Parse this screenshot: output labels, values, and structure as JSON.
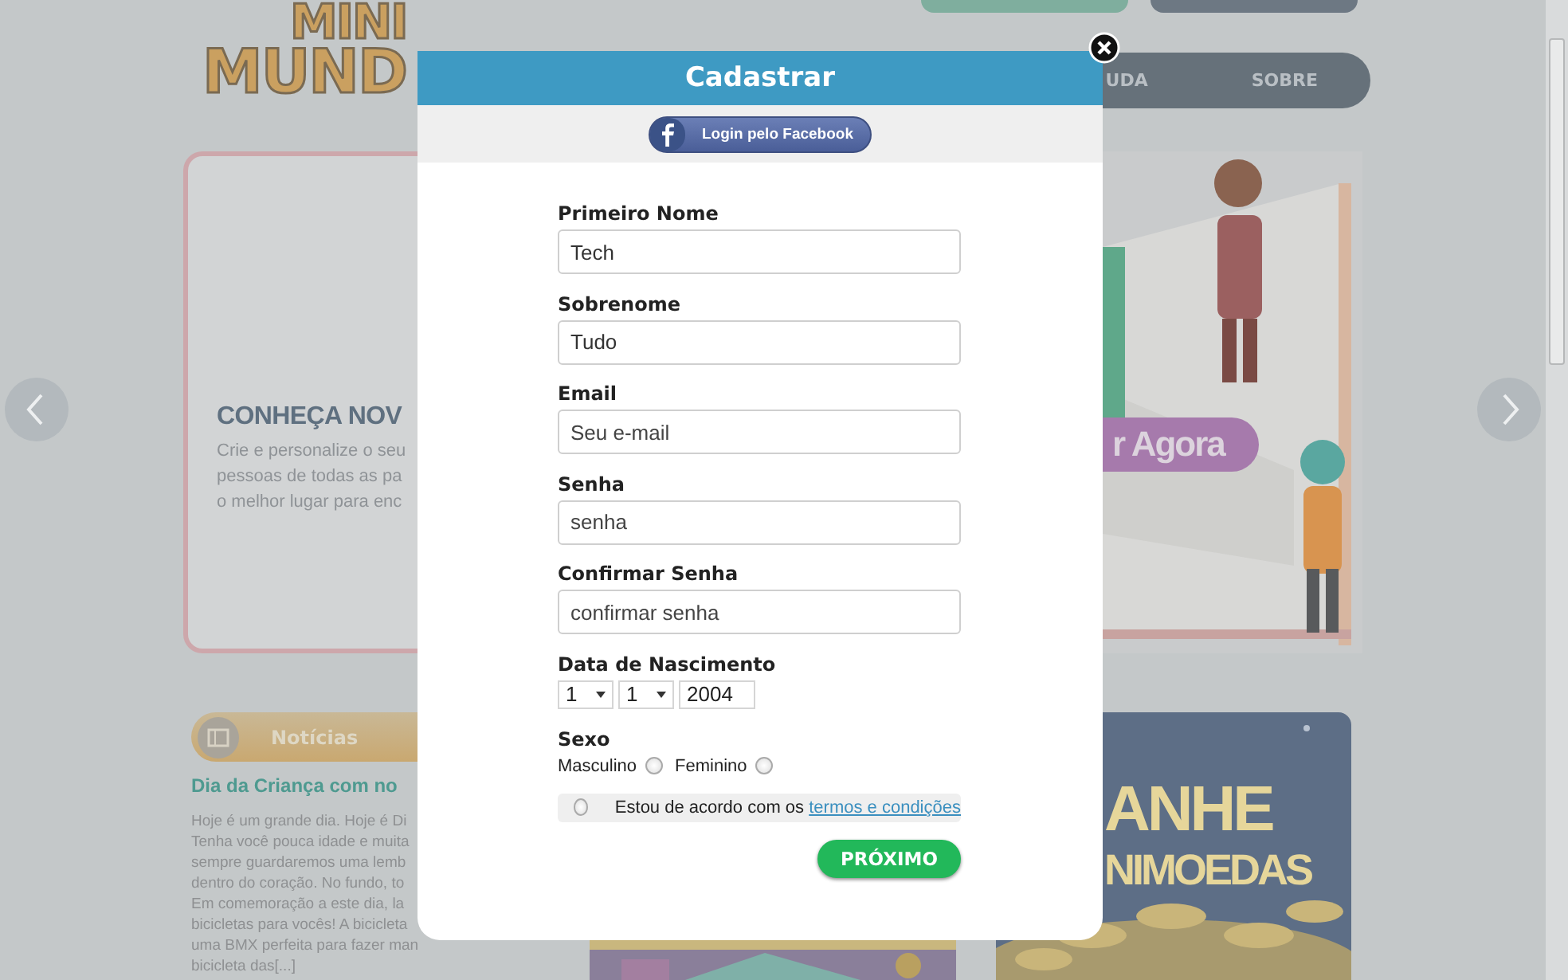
{
  "background": {
    "logo": [
      "MINI",
      "MUND"
    ],
    "nav": [
      "UDA",
      "SOBRE"
    ],
    "hero": {
      "title": "CONHEÇA NOV",
      "text": "Crie e personalize o seu\npessoas de todas as pa\no melhor lugar para enc",
      "button": "r Agora"
    },
    "news": {
      "heading": "Notícias",
      "title": "Dia da Criança com no",
      "text": "Hoje é um grande dia. Hoje é Di\nTenha você pouca idade e muita\nsempre guardaremos uma lemb\ndentro do coração. No fundo, to\nEm comemoração a este dia, la\nbicicletas para vocês! A bicicleta\numa BMX perfeita para fazer man\nbicicleta das[...]"
    },
    "banner": {
      "lines": [
        "ANHE",
        "NIMOEDAS"
      ]
    }
  },
  "modal": {
    "title": "Cadastrar",
    "facebook_button": "Login pelo Facebook",
    "fields": [
      {
        "label": "Primeiro Nome",
        "value": "Tech"
      },
      {
        "label": "Sobrenome",
        "value": "Tudo"
      },
      {
        "label": "Email",
        "placeholder": "Seu e-mail"
      },
      {
        "label": "Senha",
        "placeholder": "senha"
      },
      {
        "label": "Confirmar Senha",
        "placeholder": "confirmar senha"
      }
    ],
    "birth_date": {
      "label": "Data de Nascimento",
      "selects": [
        "1",
        "1",
        "2004"
      ]
    },
    "sex": {
      "label": "Sexo",
      "options": [
        {
          "label": "Masculino",
          "selected": false
        },
        {
          "label": "Feminino",
          "selected": false
        }
      ]
    },
    "terms": {
      "checked": false,
      "text": "Estou de acordo com os",
      "link": "termos e condições"
    },
    "next_button": "PRÓXIMO"
  }
}
